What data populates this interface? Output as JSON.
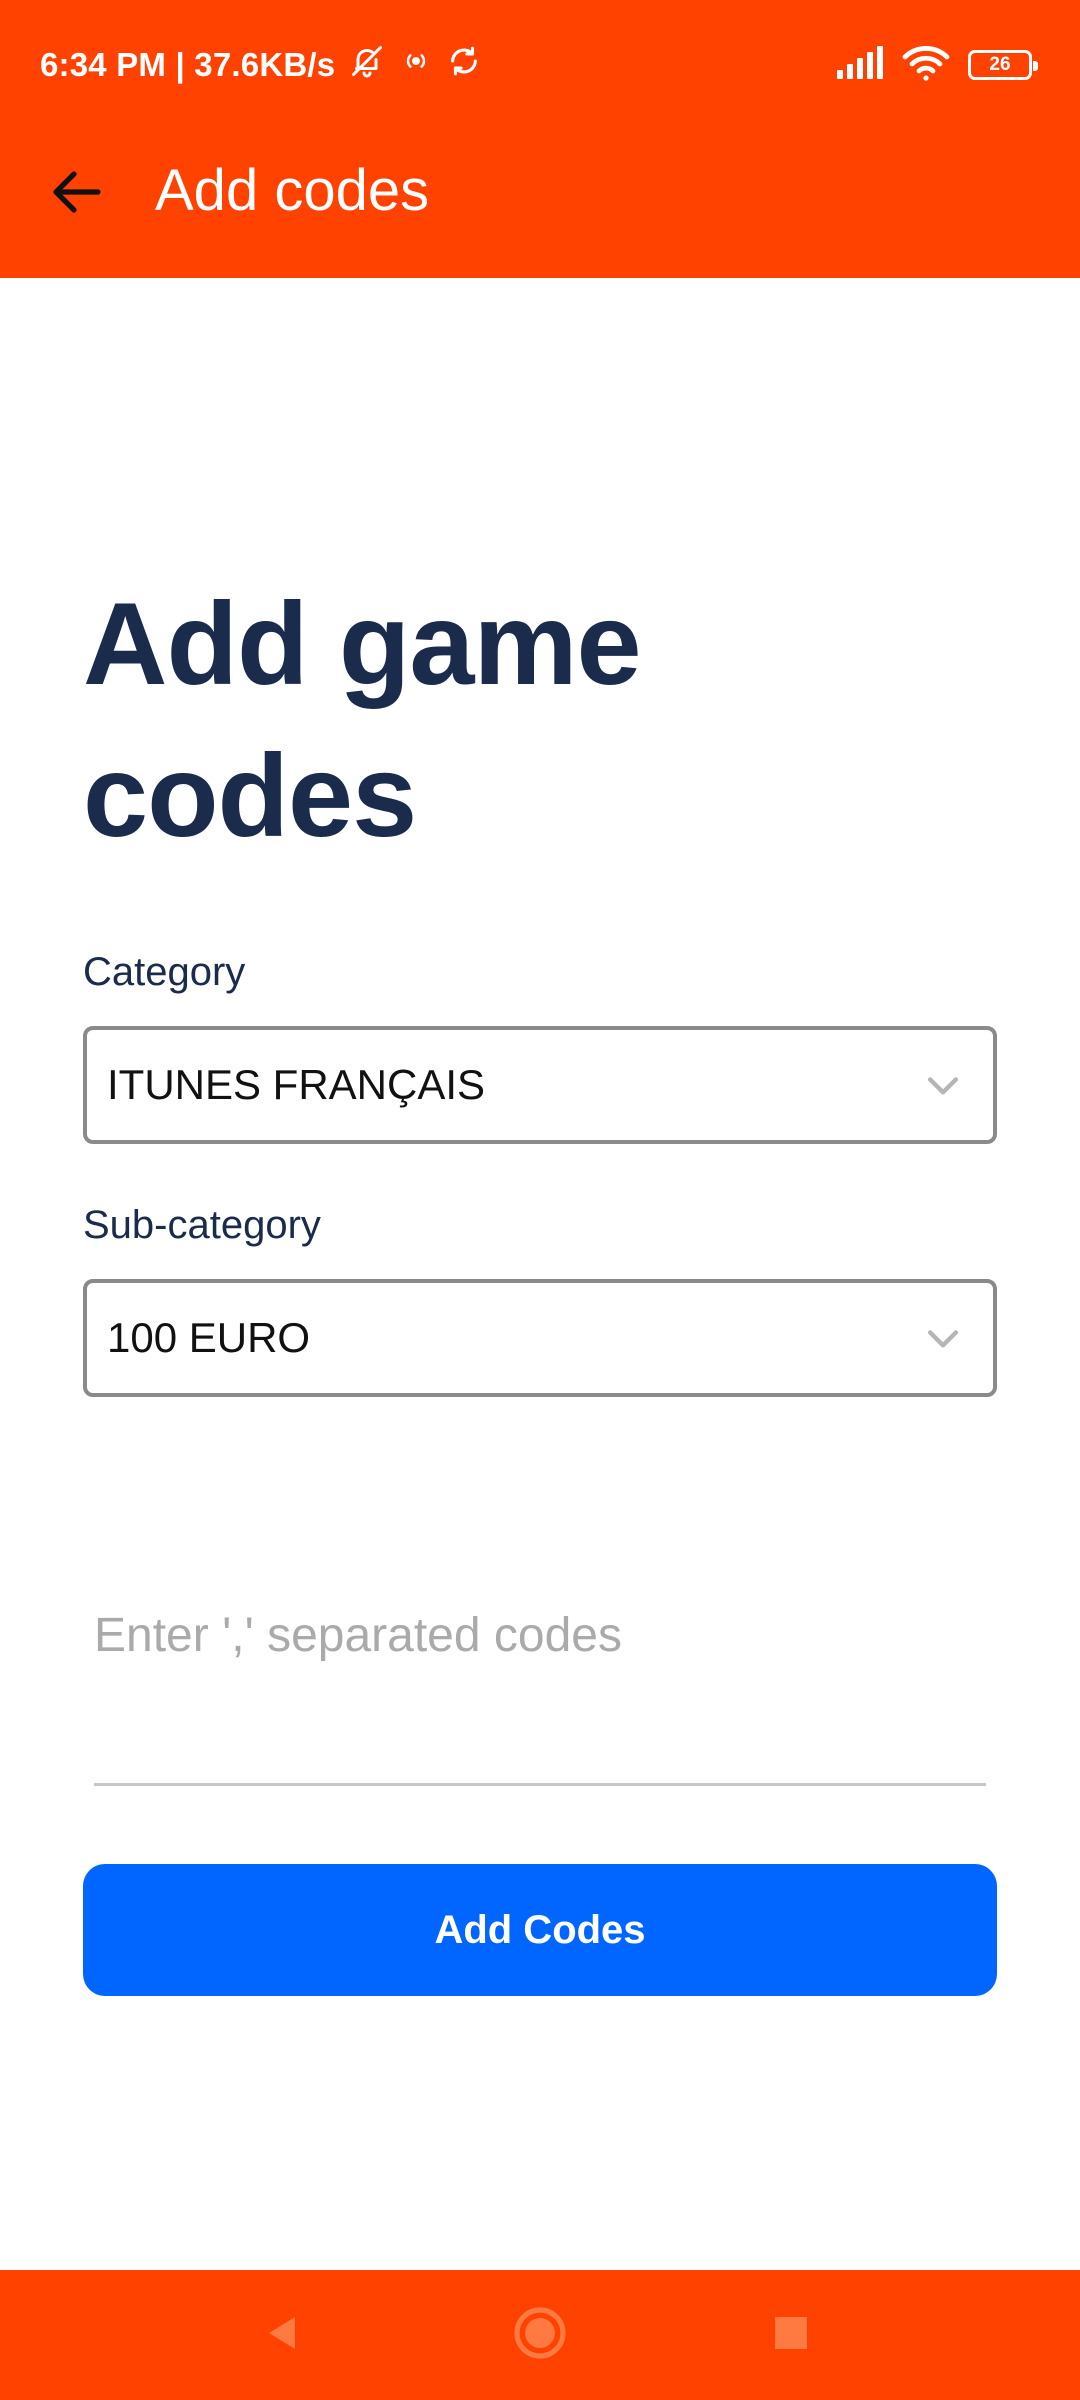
{
  "status_bar": {
    "time_and_speed": "6:34 PM | 37.6KB/s",
    "battery_level": "26",
    "icons": [
      "bell-muted-icon",
      "hotspot-icon",
      "sync-icon",
      "signal-icon",
      "wifi-icon",
      "battery-icon"
    ]
  },
  "app_bar": {
    "title": "Add codes",
    "back_icon": "arrow-left-icon"
  },
  "main": {
    "heading": "Add game codes",
    "category": {
      "label": "Category",
      "value": "ITUNES FRANÇAIS"
    },
    "subcategory": {
      "label": "Sub-category",
      "value": "100 EURO"
    },
    "codes_input": {
      "value": "",
      "placeholder": "Enter ',' separated codes"
    },
    "submit_label": "Add Codes"
  },
  "nav_bar": {
    "icons": [
      "back-triangle-icon",
      "home-circle-icon",
      "recents-square-icon"
    ]
  },
  "colors": {
    "brand": "#ff4200",
    "heading": "#1a2b4c",
    "button": "#0066ff"
  }
}
